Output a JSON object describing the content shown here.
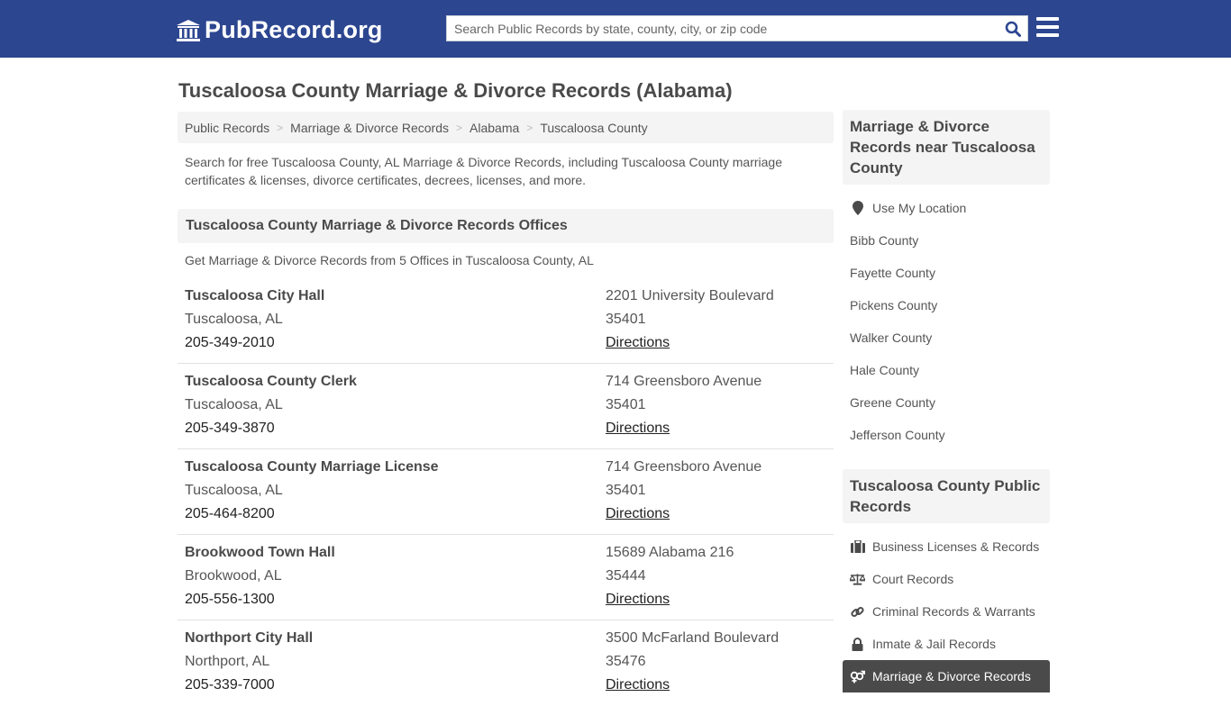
{
  "header": {
    "logo_text": "PubRecord.org",
    "search_placeholder": "Search Public Records by state, county, city, or zip code"
  },
  "page_title": "Tuscaloosa County Marriage & Divorce Records (Alabama)",
  "breadcrumb": [
    "Public Records",
    "Marriage & Divorce Records",
    "Alabama",
    "Tuscaloosa County"
  ],
  "intro": "Search for free Tuscaloosa County, AL Marriage & Divorce Records, including Tuscaloosa County marriage certificates & licenses, divorce certificates, decrees, licenses, and more.",
  "offices": {
    "title": "Tuscaloosa County Marriage & Divorce Records Offices",
    "subtitle": "Get Marriage & Divorce Records from 5 Offices in Tuscaloosa County, AL",
    "directions_label": "Directions",
    "items": [
      {
        "name": "Tuscaloosa City Hall",
        "city": "Tuscaloosa, AL",
        "phone": "205-349-2010",
        "address": "2201 University Boulevard",
        "zip": "35401"
      },
      {
        "name": "Tuscaloosa County Clerk",
        "city": "Tuscaloosa, AL",
        "phone": "205-349-3870",
        "address": "714 Greensboro Avenue",
        "zip": "35401"
      },
      {
        "name": "Tuscaloosa County Marriage License",
        "city": "Tuscaloosa, AL",
        "phone": "205-464-8200",
        "address": "714 Greensboro Avenue",
        "zip": "35401"
      },
      {
        "name": "Brookwood Town Hall",
        "city": "Brookwood, AL",
        "phone": "205-556-1300",
        "address": "15689 Alabama 216",
        "zip": "35444"
      },
      {
        "name": "Northport City Hall",
        "city": "Northport, AL",
        "phone": "205-339-7000",
        "address": "3500 McFarland Boulevard",
        "zip": "35476"
      }
    ]
  },
  "sidebar": {
    "nearby_title": "Marriage & Divorce Records near Tuscaloosa County",
    "use_location": "Use My Location",
    "nearby": [
      "Bibb County",
      "Fayette County",
      "Pickens County",
      "Walker County",
      "Hale County",
      "Greene County",
      "Jefferson County"
    ],
    "public_title": "Tuscaloosa County Public Records",
    "public": [
      {
        "label": "Business Licenses & Records",
        "icon": "briefcase-icon"
      },
      {
        "label": "Court Records",
        "icon": "balance-scale-icon"
      },
      {
        "label": "Criminal Records & Warrants",
        "icon": "link-icon"
      },
      {
        "label": "Inmate & Jail Records",
        "icon": "lock-icon"
      },
      {
        "label": "Marriage & Divorce Records",
        "icon": "gender-icon",
        "active": true
      }
    ]
  },
  "colors": {
    "brand": "#2c4690",
    "search_icon": "#2c4690",
    "active_bg": "#4a4a4a"
  }
}
